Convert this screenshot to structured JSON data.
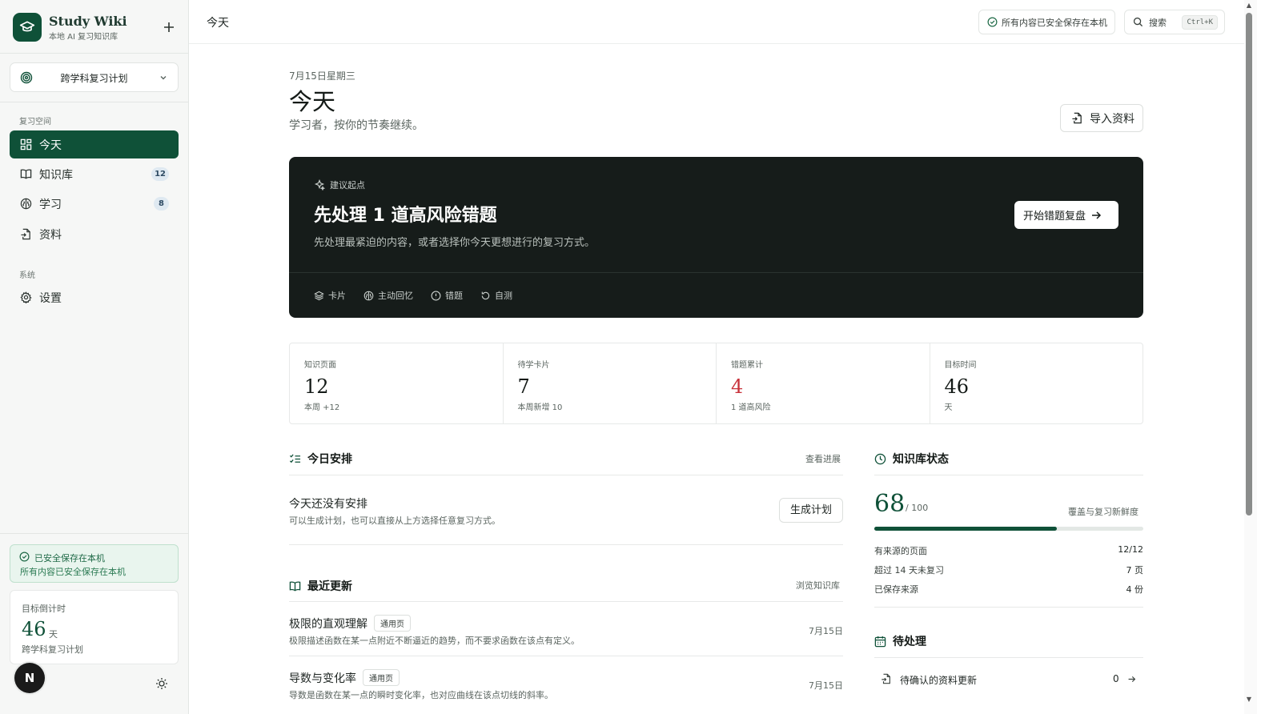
{
  "brand": {
    "title": "Study Wiki",
    "subtitle": "本地 AI 复习知识库"
  },
  "plan_selector": {
    "label": "跨学科复习计划"
  },
  "sidebar": {
    "section_review": "复习空间",
    "items": [
      {
        "label": "今天",
        "icon": "grid-icon",
        "active": true
      },
      {
        "label": "知识库",
        "icon": "book-open-icon",
        "badge": "12"
      },
      {
        "label": "学习",
        "icon": "brain-icon",
        "badge": "8"
      },
      {
        "label": "资料",
        "icon": "file-import-icon"
      }
    ],
    "section_system": "系统",
    "settings_label": "设置",
    "saved_title": "已安全保存在本机",
    "saved_sub": "所有内容已安全保存在本机",
    "countdown": {
      "label": "目标倒计时",
      "value": "46",
      "unit": "天",
      "plan": "跨学科复习计划"
    },
    "avatar_letter": "N"
  },
  "topbar": {
    "breadcrumb": "今天",
    "saved_status": "所有内容已安全保存在本机",
    "search_label": "搜索",
    "search_shortcut": "Ctrl+K"
  },
  "header": {
    "date": "7月15日星期三",
    "title": "今天",
    "subtitle": "学习者，按你的节奏继续。",
    "import_label": "导入资料"
  },
  "hero": {
    "kicker": "建议起点",
    "headline": "先处理 1 道高风险错题",
    "description": "先处理最紧迫的内容，或者选择你今天更想进行的复习方式。",
    "cta": "开始错题复盘",
    "modes": [
      {
        "label": "卡片",
        "icon": "layers-icon"
      },
      {
        "label": "主动回忆",
        "icon": "brain-icon"
      },
      {
        "label": "错题",
        "icon": "alert-circle-icon"
      },
      {
        "label": "自测",
        "icon": "rotate-icon"
      }
    ]
  },
  "stats": [
    {
      "label": "知识页面",
      "value": "12",
      "note": "本周 +12"
    },
    {
      "label": "待学卡片",
      "value": "7",
      "note": "本周新增 10"
    },
    {
      "label": "错题累计",
      "value": "4",
      "note": "1 道高风险",
      "color": "#c8313a"
    },
    {
      "label": "目标时间",
      "value": "46",
      "note": "天"
    }
  ],
  "today_plan": {
    "title": "今日安排",
    "link": "查看进展",
    "empty_title": "今天还没有安排",
    "empty_sub": "可以生成计划，也可以直接从上方选择任意复习方式。",
    "generate_label": "生成计划"
  },
  "recent_updates": {
    "title": "最近更新",
    "link": "浏览知识库",
    "items": [
      {
        "title": "极限的直观理解",
        "tag": "通用页",
        "desc": "极限描述函数在某一点附近不断逼近的趋势，而不要求函数在该点有定义。",
        "date": "7月15日"
      },
      {
        "title": "导数与变化率",
        "tag": "通用页",
        "desc": "导数是函数在某一点的瞬时变化率，也对应曲线在该点切线的斜率。",
        "date": "7月15日"
      }
    ]
  },
  "kb_status": {
    "title": "知识库状态",
    "score": "68",
    "total": "/ 100",
    "caption": "覆盖与复习新鲜度",
    "progress": 0.68,
    "rows": [
      {
        "label": "有来源的页面",
        "value": "12/12"
      },
      {
        "label": "超过 14 天未复习",
        "value": "7 页"
      },
      {
        "label": "已保存来源",
        "value": "4 份"
      }
    ]
  },
  "pending": {
    "title": "待处理",
    "items": [
      {
        "label": "待确认的资料更新",
        "count": "0"
      }
    ]
  },
  "colors": {
    "brand_green": "#0f5138",
    "hero_bg": "#161c1a",
    "danger": "#c8313a"
  }
}
